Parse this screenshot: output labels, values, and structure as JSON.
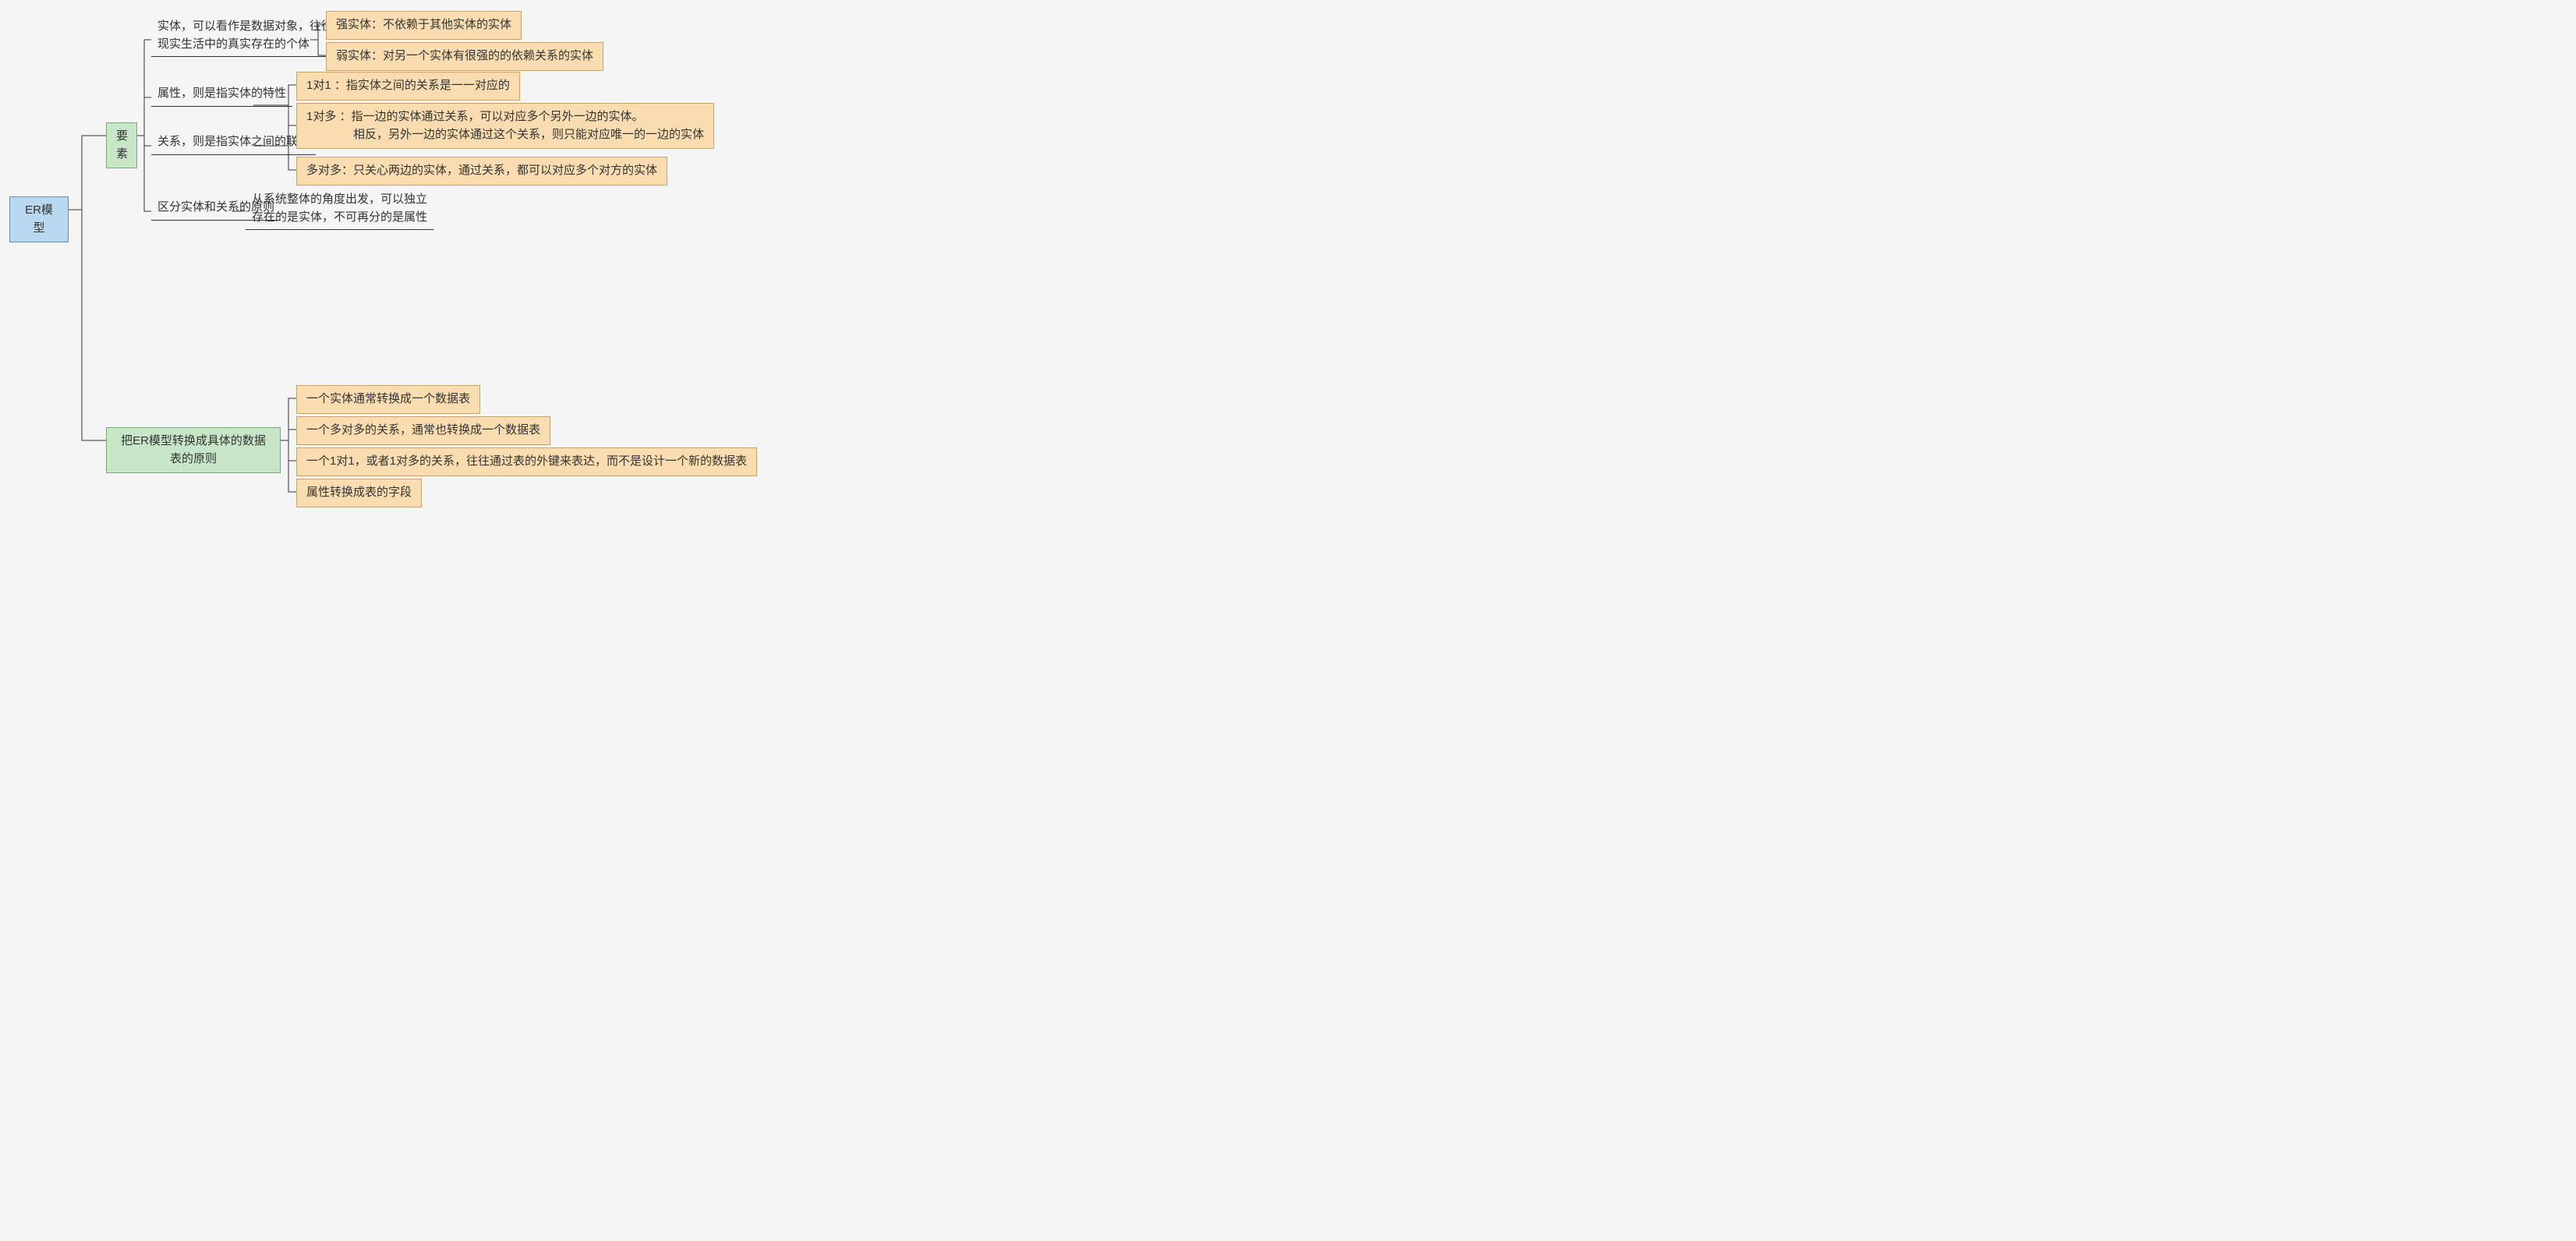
{
  "root": {
    "label": "ER模型"
  },
  "elements": {
    "label": "要素",
    "entity": {
      "desc": "实体，可以看作是数据对象，往往对应于\n现实生活中的真实存在的个体",
      "strong": "强实体：不依赖于其他实体的实体",
      "weak": "弱实体：对另一个实体有很强的的依赖关系的实体"
    },
    "attribute": {
      "desc": "属性，则是指实体的特性"
    },
    "relation": {
      "desc": "关系，则是指实体之间的联系",
      "one_one": "1对1 ：指实体之间的关系是一一对应的",
      "one_many": "1对多 ：指一边的实体通过关系，可以对应多个另外一边的实体。\n　　　　相反，另外一边的实体通过这个关系，则只能对应唯一的一边的实体",
      "many_many": "多对多：只关心两边的实体，通过关系，都可以对应多个对方的实体"
    },
    "distinguish": {
      "label": "区分实体和关系的原则",
      "desc": "从系统整体的角度出发，可以独立\n存在的是实体，不可再分的是属性"
    }
  },
  "conversion": {
    "label": "把ER模型转换成具体的数据表的原则",
    "rules": {
      "r1": "一个实体通常转换成一个数据表",
      "r2": "一个多对多的关系，通常也转换成一个数据表",
      "r3": "一个1对1，或者1对多的关系，往往通过表的外键来表达，而不是设计一个新的数据表",
      "r4": "属性转换成表的字段"
    }
  }
}
